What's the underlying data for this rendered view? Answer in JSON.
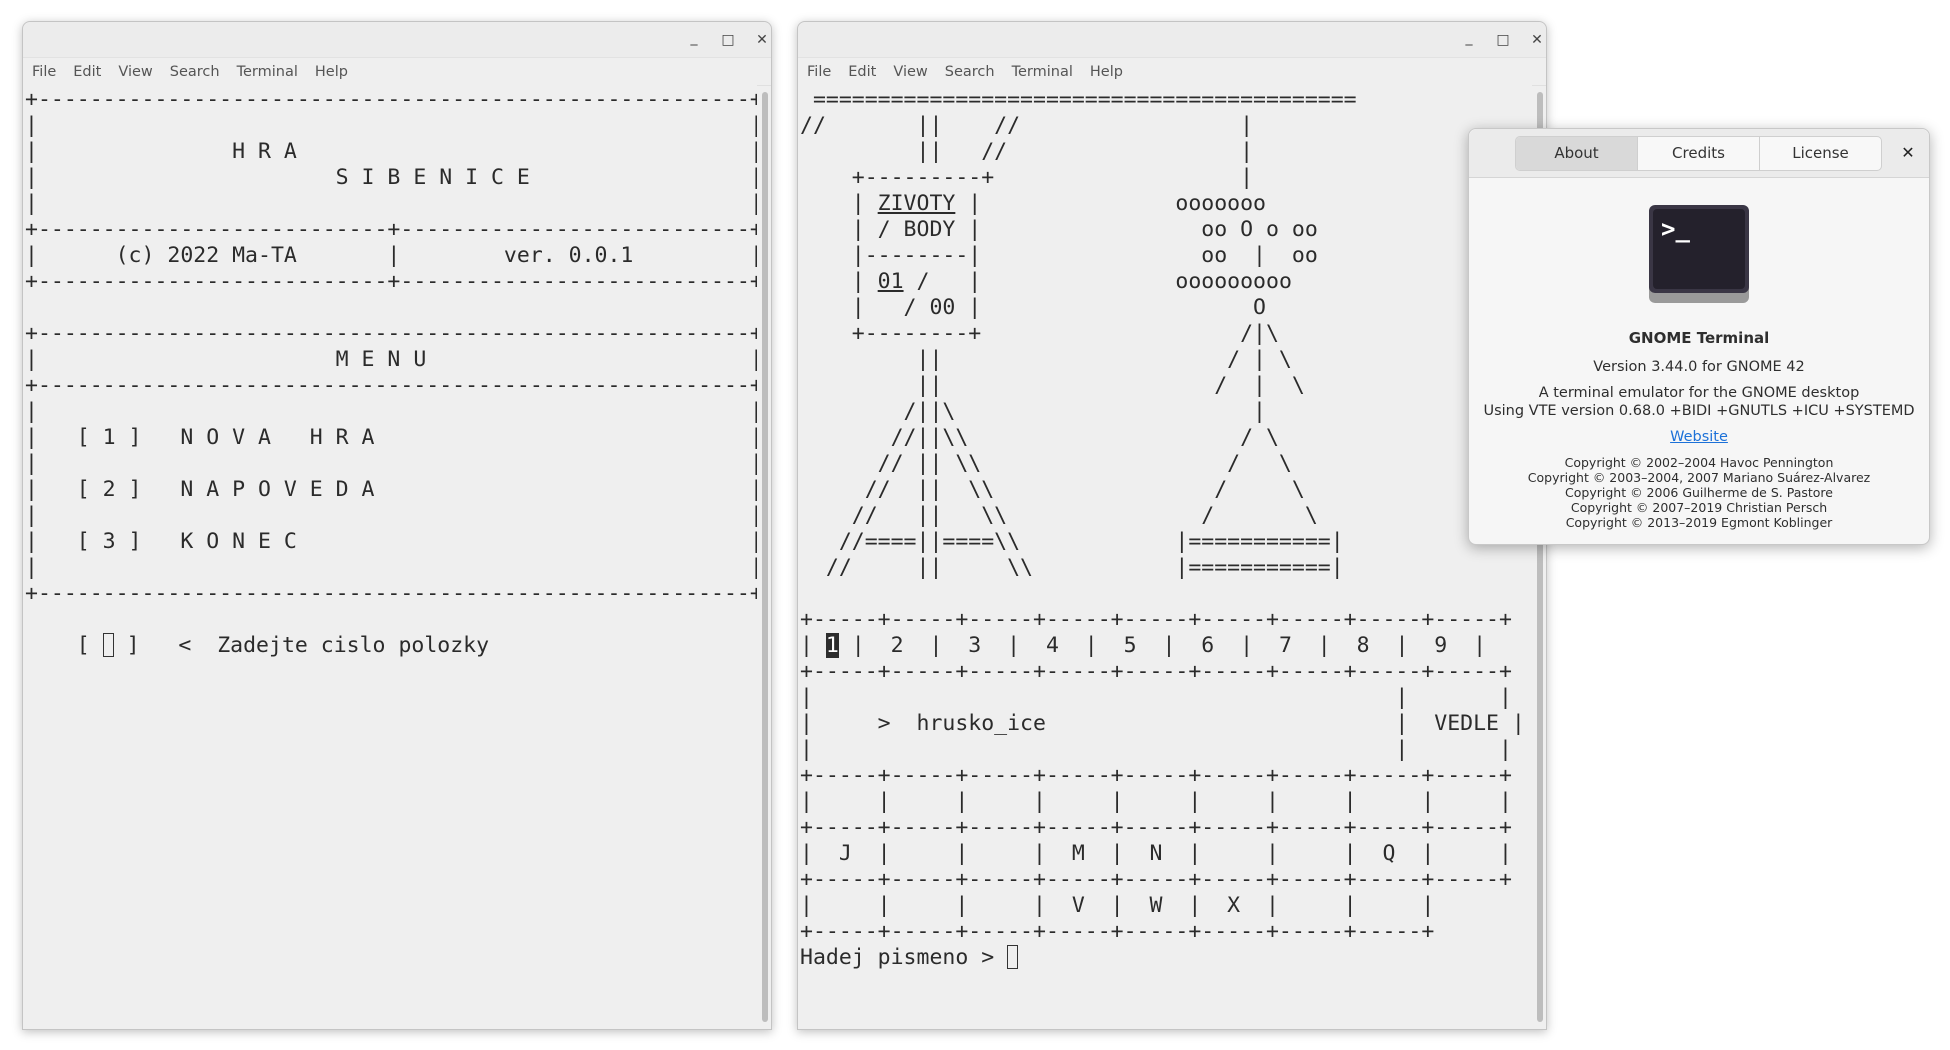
{
  "left_window": {
    "menu": [
      "File",
      "Edit",
      "View",
      "Search",
      "Terminal",
      "Help"
    ],
    "controls": {
      "minimize": "_",
      "maximize": "□",
      "close": "✕"
    },
    "lines": [
      "+-------------------------------------------------------+",
      "|                                                       |",
      "|               H R A                                   |",
      "|                       S I B E N I C E                 |",
      "|                                                       |",
      "+---------------------------+---------------------------+",
      "|      (c) 2022 Ma-TA       |        ver. 0.0.1         |",
      "+---------------------------+---------------------------+",
      "",
      "+-------------------------------------------------------+",
      "|                       M E N U                         |",
      "+-------------------------------------------------------+",
      "|                                                       |",
      "|   [ 1 ]   N O V A   H R A                             |",
      "|                                                       |",
      "|   [ 2 ]   N A P O V E D A                             |",
      "|                                                       |",
      "|   [ 3 ]   K O N E C                                   |",
      "|                                                       |",
      "+-------------------------------------------------------+",
      ""
    ],
    "prompt_prefix": "    [ ",
    "prompt_suffix": " ]   <  Zadejte cislo polozky"
  },
  "right_window": {
    "menu": [
      "File",
      "Edit",
      "View",
      "Search",
      "Terminal",
      "Help"
    ],
    "controls": {
      "minimize": "_",
      "maximize": "□",
      "close": "✕"
    },
    "art_lines": [
      " ==========================================",
      "//       ||    //                 |",
      "         ||   //                  |",
      "    +---------+                   |",
      "    | ",
      "    | / BODY |                 oo O o oo",
      "    |--------|                 oo  |  oo",
      "    | ",
      "    |   / 00 |                     O",
      "    +--------+                    /|\\",
      "         ||                      / | \\",
      "         ||                     /  |  \\",
      "        /||\\                       |",
      "       //||\\\\                     / \\",
      "      // || \\\\                   /   \\",
      "     //  ||  \\\\                 /     \\",
      "    //   ||   \\\\               /       \\",
      "   //====||====\\\\            |===========|",
      "  //     ||     \\\\           |===========|",
      ""
    ],
    "zivoty_line": {
      "pre": "    | ",
      "label": "ZIVOTY",
      "post": " |               ooooooo"
    },
    "lives_line": {
      "pre": "    | ",
      "value": "01",
      "post": " /   |               ooooooooo"
    },
    "tab_row_pre": "+-----+-----+-----+-----+-----+-----+-----+-----+-----+",
    "tabs_selected": "1",
    "tabs_rest": " |  2  |  3  |  4  |  5  |  6  |  7  |  8  |  9  |",
    "board_lines": [
      "+-----+-----+-----+-----+-----+-----+-----+-----+-----+",
      "|                                             |       |",
      "|     >  hrusko_ice                           |  VEDLE |",
      "|                                             |       |",
      "+-----+-----+-----+-----+-----+-----+-----+-----+-----+",
      "|     |     |     |     |     |     |     |     |     |",
      "+-----+-----+-----+-----+-----+-----+-----+-----+-----+",
      "|  J  |     |     |  M  |  N  |     |     |  Q  |     |",
      "+-----+-----+-----+-----+-----+-----+-----+-----+-----+",
      "|     |     |     |  V  |  W  |  X  |     |     |",
      "+-----+-----+-----+-----+-----+-----+-----+-----+"
    ],
    "prompt": "Hadej pismeno > "
  },
  "about_dialog": {
    "tabs": [
      "About",
      "Credits",
      "License"
    ],
    "close": "✕",
    "app_name": "GNOME Terminal",
    "version": "Version 3.44.0 for GNOME 42",
    "description": "A terminal emulator for the GNOME desktop",
    "vte": "Using VTE version 0.68.0 +BIDI +GNUTLS +ICU +SYSTEMD",
    "website": "Website",
    "copyrights": [
      "Copyright © 2002–2004 Havoc Pennington",
      "Copyright © 2003–2004, 2007 Mariano Suárez-Alvarez",
      "Copyright © 2006 Guilherme de S. Pastore",
      "Copyright © 2007–2019 Christian Persch",
      "Copyright © 2013–2019 Egmont Koblinger"
    ],
    "icon": "terminal-icon",
    "icon_glyph": ">_"
  }
}
